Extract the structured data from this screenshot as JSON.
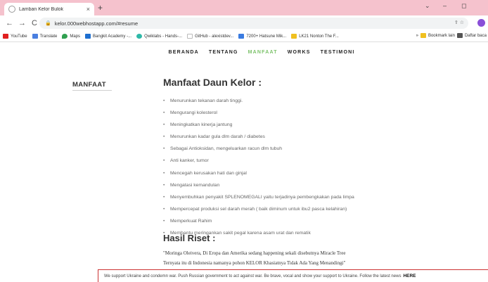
{
  "browser": {
    "tab_title": "Lamban Kelor Bulok",
    "tab_close": "×",
    "new_tab": "+",
    "url": "kelor.000webhostapp.com/#resume",
    "window_controls": [
      "⌄",
      "–",
      "◻"
    ],
    "bookmarks": [
      {
        "label": "YouTube",
        "color": "#e02020"
      },
      {
        "label": "Translate",
        "color": "#4a7fe0"
      },
      {
        "label": "Maps",
        "color": "#30a050"
      },
      {
        "label": "Bangkit Academy -...",
        "color": "#1e6fd0"
      },
      {
        "label": "Qwiklabs - Hands-...",
        "color": "#2fb9a8"
      },
      {
        "label": "GitHub - alexistdev...",
        "color": "#ffffff"
      },
      {
        "label": "7200+ Hatsune Mik...",
        "color": "#3a7be0"
      },
      {
        "label": "LK21 Nonton The F...",
        "color": "#f0c020"
      }
    ],
    "bookmarks_overflow": "»",
    "bookmarks_right": [
      {
        "label": "Bookmark lain",
        "color": "#f0c020"
      },
      {
        "label": "Daftar baca",
        "color": "#555555"
      }
    ]
  },
  "site": {
    "nav": [
      "BERANDA",
      "TENTANG",
      "MANFAAT",
      "WORKS",
      "TESTIMONI"
    ],
    "active_nav": "MANFAAT",
    "accent_color": "#7cc26a"
  },
  "content": {
    "section_label": "MANFAAT",
    "heading": "Manfaat Daun Kelor :",
    "benefits": [
      "Menurunkan tekanan darah tinggi.",
      "Mengurangi kolesterol",
      "Meningkatkan kinerja jantung",
      "Menurunkan kadar gula dlm darah / diabetes",
      "Sebagai Antioksidan, mengeluarkan racun dlm tubuh",
      "Anti kanker, tumor",
      "Mencegah kerusakan hati dan ginjal",
      "Mengatasi kemandulan",
      "Menyembuhkan penyakit SPLENOMEGALI yaitu terjadinya pembengkakan pada limpa",
      "Mempercepat produksi sel darah merah ( baik diminum untuk ibu2 pasca kelahiran)",
      "Memperkuat Rahim",
      "Membantu meringankan sakit pegal karena asam urat dan rematik"
    ],
    "research_heading": "Hasil Riset :",
    "research_quote": [
      "\"Moringa Oleivera, Di Eropa dan Amerika sedang happening sekali disebutnya Miracle Tree",
      "Ternyata itu di Indonesia namanya pohon KELOR Khasiatnya Tidak Ada Yang Menandingi\""
    ]
  },
  "notice": {
    "text": "We support Ukraine and condemn war. Push Russian government to act against war. Be brave, vocal and show your support to Ukraine. Follow the latest news",
    "link": "HERE"
  }
}
